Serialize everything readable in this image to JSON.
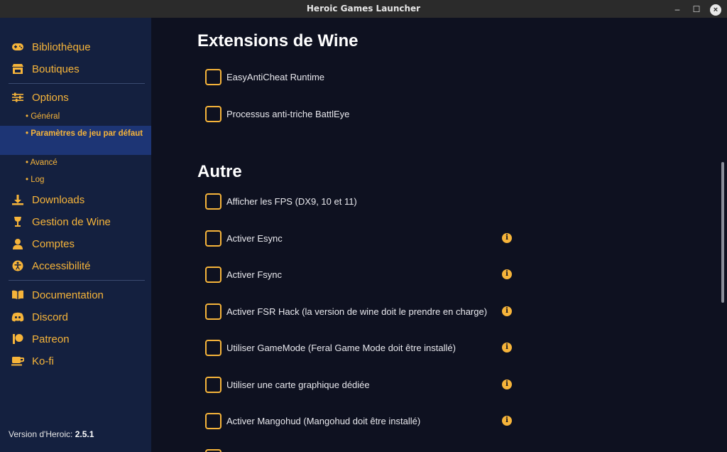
{
  "window": {
    "title": "Heroic Games Launcher",
    "minimize": "–",
    "maximize": "☐",
    "close": "×"
  },
  "sidebar": {
    "items": [
      {
        "label": "Bibliothèque",
        "icon": "gamepad-icon"
      },
      {
        "label": "Boutiques",
        "icon": "store-icon"
      },
      {
        "label": "Options",
        "icon": "sliders-icon"
      },
      {
        "label": "Downloads",
        "icon": "download-icon"
      },
      {
        "label": "Gestion de Wine",
        "icon": "wine-glass-icon"
      },
      {
        "label": "Comptes",
        "icon": "user-icon"
      },
      {
        "label": "Accessibilité",
        "icon": "accessibility-icon"
      },
      {
        "label": "Documentation",
        "icon": "book-icon"
      },
      {
        "label": "Discord",
        "icon": "discord-icon"
      },
      {
        "label": "Patreon",
        "icon": "patreon-icon"
      },
      {
        "label": "Ko-fi",
        "icon": "coffee-cup-icon"
      }
    ],
    "options_sub": [
      {
        "label": "• Général"
      },
      {
        "label": "• Paramètres de jeu par défaut",
        "active": true
      },
      {
        "label": "• Avancé"
      },
      {
        "label": "• Log"
      }
    ],
    "version_label": "Version d'Heroic:",
    "version_value": "2.5.1"
  },
  "main": {
    "wine_extensions": {
      "title": "Extensions de Wine",
      "options": [
        {
          "label": "EasyAntiCheat Runtime",
          "checked": false
        },
        {
          "label": "Processus anti-triche BattlEye",
          "checked": false
        }
      ]
    },
    "other": {
      "title": "Autre",
      "options": [
        {
          "label": "Afficher les FPS (DX9, 10 et 11)",
          "checked": false,
          "info": false
        },
        {
          "label": "Activer Esync",
          "checked": false,
          "info": true
        },
        {
          "label": "Activer Fsync",
          "checked": false,
          "info": true
        },
        {
          "label": "Activer FSR Hack (la version de wine doit le prendre en charge)",
          "checked": false,
          "info": true
        },
        {
          "label": "Utiliser GameMode (Feral Game Mode doit être installé)",
          "checked": false,
          "info": true
        },
        {
          "label": "Utiliser une carte graphique dédiée",
          "checked": false,
          "info": true
        },
        {
          "label": "Activer Mangohud (Mangohud doit être installé)",
          "checked": false,
          "info": true
        }
      ]
    },
    "info_glyph": "i"
  },
  "colors": {
    "accent": "#f6b43a",
    "sidebar_bg": "#14203f",
    "active_bg": "#1d3575",
    "main_bg": "#0e1120"
  }
}
